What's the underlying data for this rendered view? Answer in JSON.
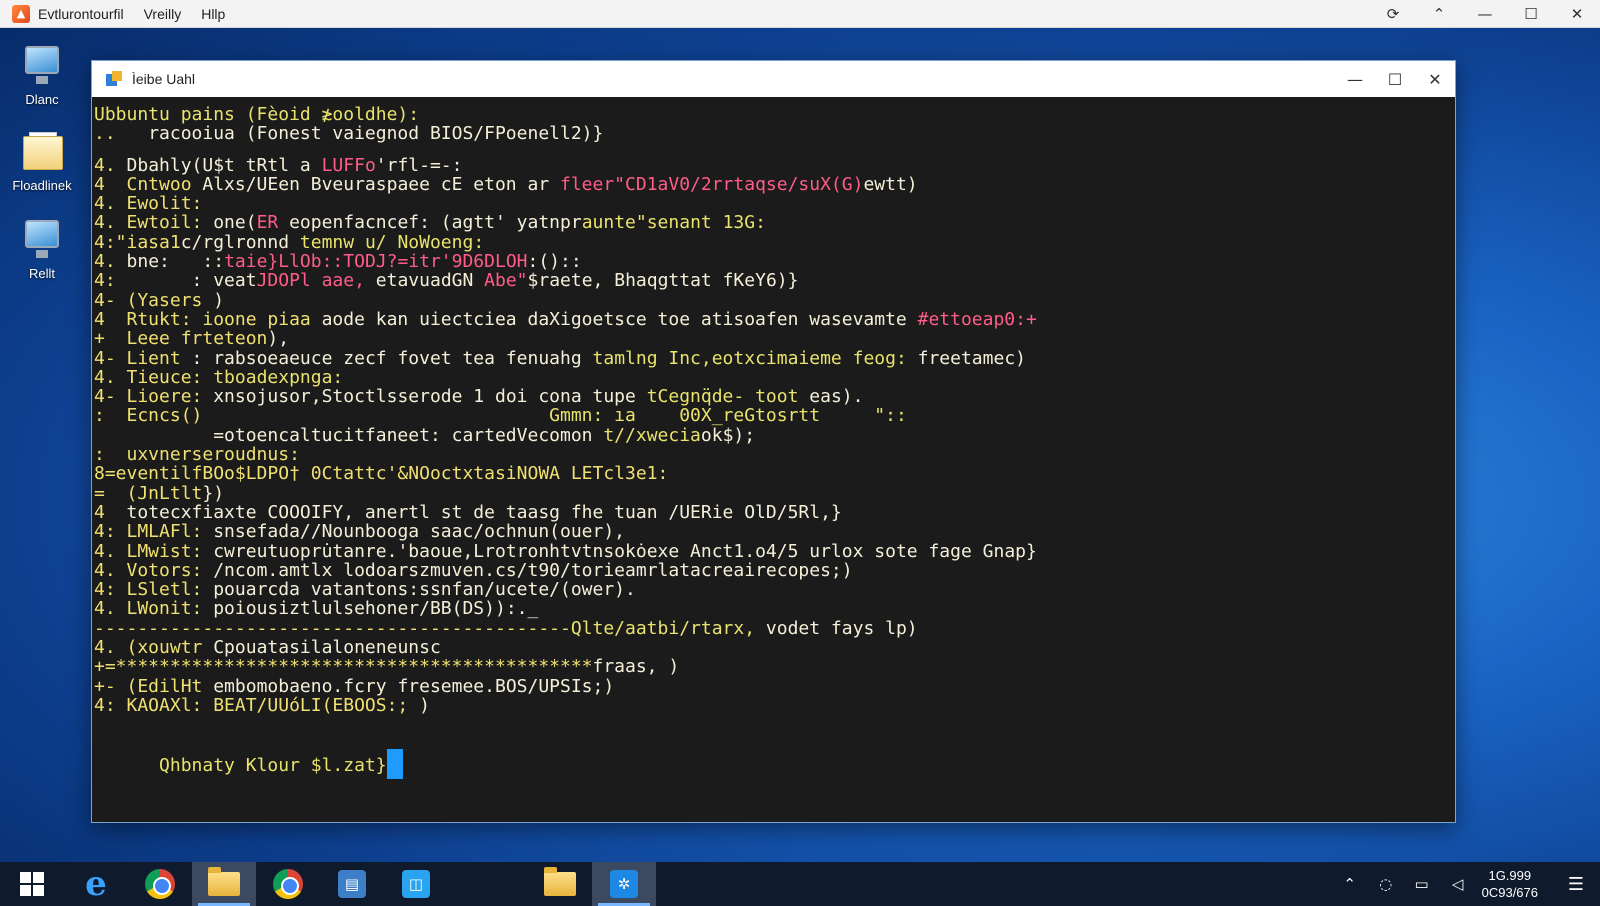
{
  "menubar": {
    "app_icon": "app-logo-icon",
    "items": [
      "Evtlurontourfil",
      "Vreilly",
      "Hllp"
    ],
    "controls": [
      "sync-icon",
      "arrow-up-icon",
      "minimize-icon",
      "maximize-icon",
      "close-icon"
    ]
  },
  "desktop": {
    "icons": [
      {
        "label": "Dlanc",
        "icon": "computer-icon"
      },
      {
        "label": "Floadlinek",
        "icon": "folder-icon"
      },
      {
        "label": "Rellt",
        "icon": "monitor-icon"
      }
    ]
  },
  "window": {
    "title": "Ìeibe Uahl",
    "controls": [
      "minimize-icon",
      "maximize-icon",
      "close-icon"
    ]
  },
  "terminal": {
    "lines": [
      [
        [
          "yel",
          "Ubbuntu pains (Fèoid ≵ooldhe):"
        ]
      ],
      [
        [
          "yel",
          "..   "
        ],
        [
          "wht",
          "racooiua (Fonest vaiegnod BIOS/FPoenell2)}"
        ]
      ],
      [],
      [
        [
          "pfx",
          "4. "
        ],
        [
          "wht",
          "Dbahly(U$t tRtl a "
        ],
        [
          "pnk",
          "LUFFo"
        ],
        [
          "wht",
          "'rfl-=-:"
        ]
      ],
      [
        [
          "pfx",
          "4  Cntwoo "
        ],
        [
          "wht",
          "Alxs/UEen Bveuraspaee cE eton ar "
        ],
        [
          "pnk",
          "fleer\"CD1aV0/2rrtaqse/suX(G)"
        ],
        [
          "wht",
          "ewtt)"
        ]
      ],
      [
        [
          "pfx",
          "4. Ewolit:"
        ]
      ],
      [
        [
          "pfx",
          "4. Ewtoil: "
        ],
        [
          "wht",
          "one("
        ],
        [
          "pnk",
          "ER "
        ],
        [
          "wht",
          "eopenfacncef: (agtt' yatnpr"
        ],
        [
          "yel",
          "aunte\"senant 13G:"
        ]
      ],
      [
        [
          "pfx",
          "4:\"iasa1"
        ],
        [
          "wht",
          "c/rglronnd "
        ],
        [
          "yel",
          "temnw u/ NoWoeng:"
        ]
      ],
      [
        [
          "pfx",
          "4. "
        ],
        [
          "wht",
          "bne:   ::"
        ],
        [
          "pnk",
          "taie}LlOb::TODJ?=itr'9D6DLOH"
        ],
        [
          "wht",
          ":()::"
        ]
      ],
      [
        [
          "pfx",
          "4:       "
        ],
        [
          "wht",
          ": veat"
        ],
        [
          "pnk",
          "JDOPl aae, "
        ],
        [
          "wht",
          "etavuadGN "
        ],
        [
          "pnk",
          "Abe\""
        ],
        [
          "wht",
          "$raete, Bhaqgttat fKeY6)}"
        ]
      ],
      [
        [
          "pfx",
          "4- (Yasers "
        ],
        [
          "wht",
          ")"
        ]
      ],
      [
        [
          "pfx",
          "4  Rtukt: ioone piaa "
        ],
        [
          "wht",
          "aode kan uiectciea daXigoetsce toe atisoafen wasevamte "
        ],
        [
          "pnk",
          "#ettoeap0:+"
        ]
      ],
      [
        [
          "pfx",
          "+  Leee frteteon"
        ],
        [
          "wht",
          "),"
        ]
      ],
      [
        [
          "pfx",
          "4- Lient "
        ],
        [
          "wht",
          ": rabsoeaeuce zecf fovet tea fenuahg "
        ],
        [
          "yel",
          "tamlng Inc,eotxcimaieme feog: "
        ],
        [
          "wht",
          "freetamec)"
        ]
      ],
      [
        [
          "pfx",
          "4. Tieuce: "
        ],
        [
          "yel",
          "tboadexpnga:"
        ]
      ],
      [
        [
          "pfx",
          "4- Lioere: "
        ],
        [
          "wht",
          "xnsojusor,Stoctlsserode 1 doi cona tupe "
        ],
        [
          "yel",
          "tCegnq̈de- toot "
        ],
        [
          "wht",
          "eas)."
        ]
      ],
      [
        [
          "pfx",
          ":  Ecncs()                                "
        ],
        [
          "yel",
          "Gmmn: ıa    00X_reGtosrtt     \":: "
        ]
      ],
      [
        [
          "wht",
          "           =otoencaltucitfaneet: cartedVecomon "
        ],
        [
          "yel",
          "t//xwecia"
        ],
        [
          "wht",
          "ok$);"
        ]
      ],
      [
        [
          "pfx",
          ":  uxvnerseroudnus:"
        ]
      ],
      [
        [
          "pfx",
          "8=eventilfBOo$LDPO† 0Ctattc'&NOoctxtasiNOWA LETcl3e1:"
        ]
      ],
      [
        [
          "pfx",
          "=  (JnLtlt"
        ],
        [
          "wht",
          "})"
        ]
      ],
      [
        [
          "pfx",
          "4  "
        ],
        [
          "wht",
          "totecxfiaxte COOOIFY, anertl st de taasg fhe tuan /UERie OlD/5Rl,}"
        ]
      ],
      [
        [
          "pfx",
          "4: LMLAFl: "
        ],
        [
          "wht",
          "snsefada//Nounbooga saac/ochnun(ouer),"
        ]
      ],
      [
        [
          "pfx",
          "4. LMwist: "
        ],
        [
          "wht",
          "cwreutuopru̇tanre.'baoue,Lrotronhtvtnsokȯexe Anct1.o4/5 urlox sote fage Gnap}"
        ]
      ],
      [
        [
          "pfx",
          "4. Votors: "
        ],
        [
          "wht",
          "/ncom.amtlx lodoarszmuven.cs/t90/torieamrlatacreairecopes;)"
        ]
      ],
      [
        [
          "pfx",
          "4: LSletl: "
        ],
        [
          "wht",
          "pouarcda vatantons:ssnfan/ucete/(ower)."
        ]
      ],
      [
        [
          "pfx",
          "4. LWonit: "
        ],
        [
          "wht",
          "poiousiztlulsehoner/BB(DS)):._"
        ]
      ],
      [
        [
          "pfx",
          "--------------------------------------------"
        ],
        [
          "yel",
          "Qlte/aatbi/rtarx, "
        ],
        [
          "wht",
          "vodet fays lp)"
        ]
      ],
      [
        [
          "pfx",
          "4. (xouwtr "
        ],
        [
          "wht",
          "Cpouatasilaloneneunsc"
        ]
      ],
      [
        [
          "pfx",
          "+=********************************************"
        ],
        [
          "wht",
          "fraas, )"
        ]
      ],
      [
        [
          "pfx",
          "+- (EdilHt "
        ],
        [
          "wht",
          "embomobaeno.fcry fresemee.BOS/UPSIs;)"
        ]
      ],
      [
        [
          "pfx",
          "4: KAOAXl: BEAT/UUóLI(EBOOS:; "
        ],
        [
          "wht",
          ")"
        ]
      ]
    ],
    "prompt": "Qhbnaty Klour $l.zat}"
  },
  "taskbar": {
    "apps": [
      "windows-start-icon",
      "edge-icon",
      "chrome-icon",
      "file-explorer-icon",
      "chrome-icon",
      "outlook-icon",
      "store-icon",
      "folder-icon",
      "terminal-app-icon"
    ],
    "clock_time": "1G.999",
    "clock_date": "0C93/676",
    "tray": [
      "chevron-up-icon",
      "network-icon",
      "display-icon",
      "speaker-icon",
      "notification-icon"
    ]
  },
  "colors": {
    "terminal_bg": "#1b1b1b",
    "prompt_yellow": "#e9e36b",
    "accent_pink": "#ff5c8a",
    "cursor_blue": "#1e9bff",
    "taskbar_bg": "#0f1b2d"
  }
}
